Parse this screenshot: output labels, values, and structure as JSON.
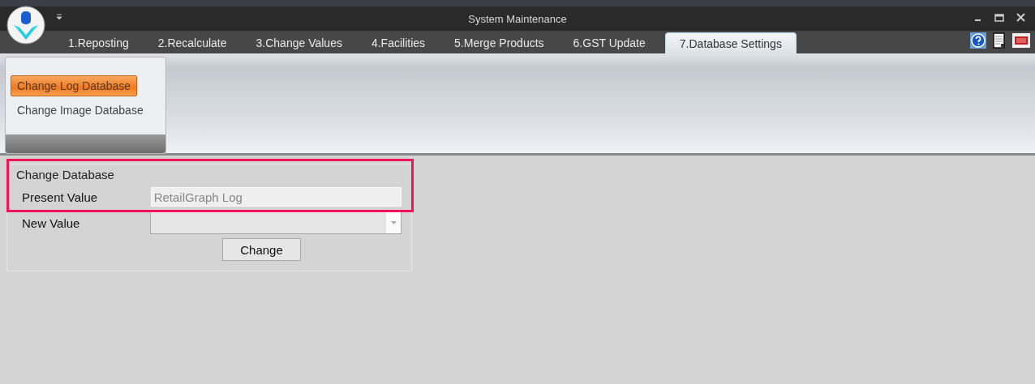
{
  "window": {
    "title": "System Maintenance"
  },
  "tabs": [
    {
      "label": "1.Reposting",
      "selected": false
    },
    {
      "label": "2.Recalculate",
      "selected": false
    },
    {
      "label": "3.Change Values",
      "selected": false
    },
    {
      "label": "4.Facilities",
      "selected": false
    },
    {
      "label": "5.Merge Products",
      "selected": false
    },
    {
      "label": "6.GST Update",
      "selected": false
    },
    {
      "label": "7.Database Settings",
      "selected": true
    }
  ],
  "ribbon": {
    "items": [
      {
        "label": "Change Log Database",
        "selected": true
      },
      {
        "label": "Change Image Database",
        "selected": false
      }
    ]
  },
  "form": {
    "title": "Change Database",
    "present_label": "Present Value",
    "present_value": "RetailGraph Log",
    "new_label": "New Value",
    "button": "Change",
    "highlighted": true
  }
}
